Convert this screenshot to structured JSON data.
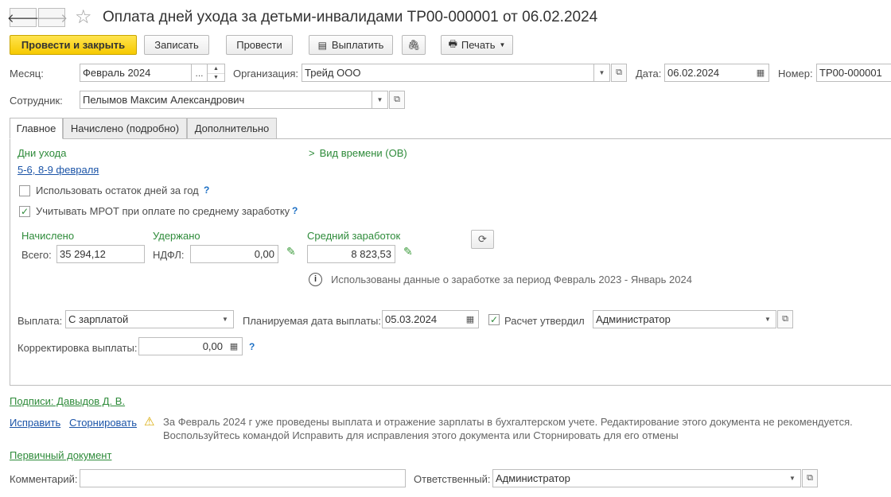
{
  "window": {
    "title": "Оплата дней ухода за детьми-инвалидами ТР00-000001 от 06.02.2024",
    "back_icon": "arrow-left-icon",
    "forward_icon": "arrow-right-icon",
    "star_icon": "star-icon"
  },
  "toolbar": {
    "post_close": "Провести и закрыть",
    "save": "Записать",
    "post": "Провести",
    "pay": "Выплатить",
    "print": "Печать"
  },
  "header": {
    "month_label": "Месяц:",
    "month_value": "Февраль 2024",
    "month_dots": "...",
    "org_label": "Организация:",
    "org_value": "Трейд ООО",
    "date_label": "Дата:",
    "date_value": "06.02.2024",
    "number_label": "Номер:",
    "number_value": "ТР00-000001",
    "employee_label": "Сотрудник:",
    "employee_value": "Пелымов Максим Александрович"
  },
  "tabs": [
    {
      "label": "Главное",
      "active": true
    },
    {
      "label": "Начислено (подробно)",
      "active": false
    },
    {
      "label": "Дополнительно",
      "active": false
    }
  ],
  "main": {
    "care_days_label": "Дни ухода",
    "care_days_value": "5-6, 8-9 февраля",
    "time_kind": "Вид времени (ОВ)",
    "use_remaining_label": "Использовать остаток дней за год",
    "use_remaining_checked": false,
    "mrot_label": "Учитывать МРОТ при оплате по среднему заработку",
    "mrot_checked": true,
    "q_mark": "?",
    "accrued_header": "Начислено",
    "withheld_header": "Удержано",
    "avg_header": "Средний заработок",
    "total_label": "Всего:",
    "total_value": "35 294,12",
    "ndfl_label": "НДФЛ:",
    "ndfl_value": "0,00",
    "avg_value": "8 823,53",
    "info_text": "Использованы данные о заработке за период Февраль 2023 - Январь 2024",
    "payment_label": "Выплата:",
    "payment_value": "С зарплатой",
    "planned_date_label": "Планируемая дата выплаты:",
    "planned_date_value": "05.03.2024",
    "approved_label": "Расчет утвердил",
    "approved_checked": true,
    "approver_value": "Администратор",
    "correction_label": "Корректировка выплаты:",
    "correction_value": "0,00"
  },
  "footer": {
    "signatures": "Подписи: Давыдов Д. В.",
    "fix_link": "Исправить",
    "reverse_link": "Сторнировать",
    "warning_line1": "За Февраль 2024 г уже проведены выплата и отражение зарплаты в бухгалтерском учете. Редактирование этого документа не рекомендуется.",
    "warning_line2": "Воспользуйтесь командой Исправить для исправления этого документа или Сторнировать для его отмены",
    "primary_doc": "Первичный документ",
    "comment_label": "Комментарий:",
    "comment_value": "",
    "responsible_label": "Ответственный:",
    "responsible_value": "Администратор"
  },
  "colors": {
    "primary_button": "#f6c900",
    "green_accent": "#2e8b3a",
    "link_blue": "#1c55a8"
  }
}
